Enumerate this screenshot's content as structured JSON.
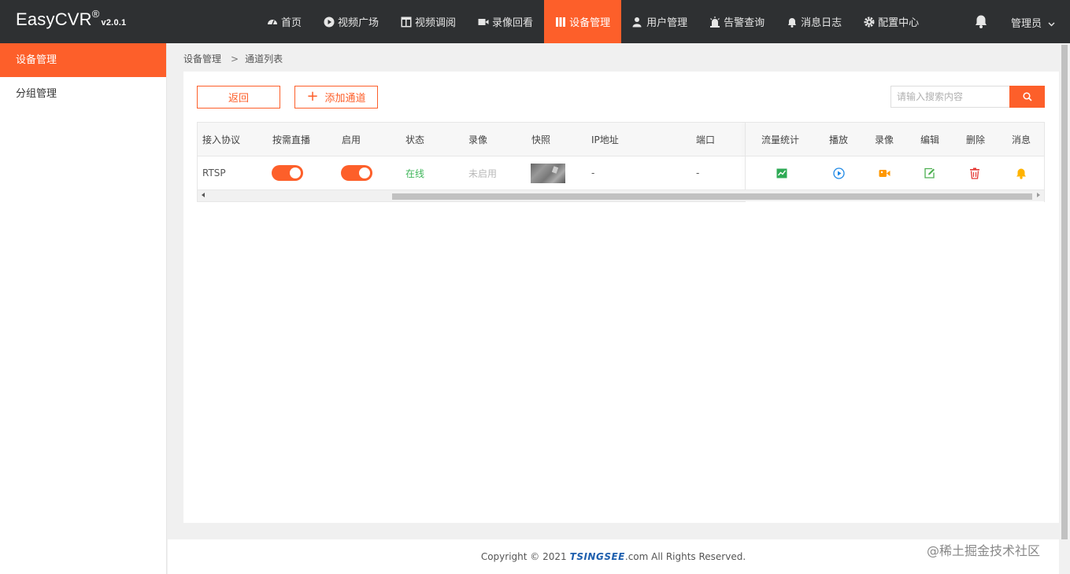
{
  "header": {
    "logo": "EasyCVR",
    "logo_mark": "®",
    "version": "v2.0.1",
    "nav": [
      {
        "label": "首页",
        "icon": "dashboard-icon"
      },
      {
        "label": "视频广场",
        "icon": "play-circle-icon"
      },
      {
        "label": "视频调阅",
        "icon": "layout-icon"
      },
      {
        "label": "录像回看",
        "icon": "video-camera-icon"
      },
      {
        "label": "设备管理",
        "icon": "device-icon",
        "active": true
      },
      {
        "label": "用户管理",
        "icon": "user-icon"
      },
      {
        "label": "告警查询",
        "icon": "alarm-icon"
      },
      {
        "label": "消息日志",
        "icon": "bell-icon"
      },
      {
        "label": "配置中心",
        "icon": "gear-icon"
      }
    ],
    "user": "管理员"
  },
  "sidebar": {
    "items": [
      {
        "label": "设备管理",
        "active": true
      },
      {
        "label": "分组管理"
      }
    ]
  },
  "breadcrumb": {
    "root": "设备管理",
    "sep": ">",
    "current": "通道列表"
  },
  "toolbar": {
    "back_label": "返回",
    "add_label": "添加通道",
    "search_placeholder": "请输入搜索内容"
  },
  "table": {
    "headers": [
      "接入协议",
      "按需直播",
      "启用",
      "状态",
      "录像",
      "快照",
      "IP地址",
      "端口",
      "流量统计",
      "播放",
      "录像",
      "编辑",
      "删除",
      "消息"
    ],
    "row": {
      "protocol": "RTSP",
      "status": "在线",
      "record": "未启用",
      "ip": "-",
      "port": "-"
    }
  },
  "footer": {
    "copyright": "Copyright © 2021",
    "brand": "TSINGSEE",
    "suffix": ".com All Rights Reserved."
  },
  "watermark": "@稀土掘金技术社区",
  "colors": {
    "accent": "#fd5f2a",
    "topbar": "#2e3032",
    "online": "#3fb65a",
    "play": "#1e88e5",
    "record": "#ff9800",
    "edit": "#4caf50",
    "delete": "#e53935",
    "bell": "#ffb300"
  }
}
